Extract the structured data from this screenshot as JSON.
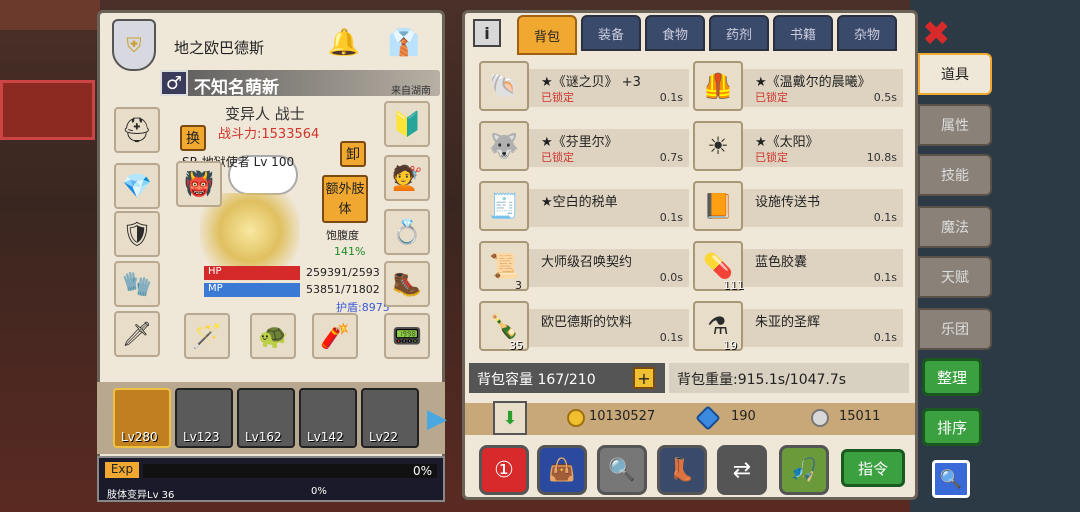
{
  "character": {
    "guild_name": "地之欧巴德斯",
    "player_name": "不知名萌新",
    "origin": "来自湖南",
    "gender_icon": "♂",
    "class": "变异人 战士",
    "power": "战斗力:1533564",
    "title": "SR  地狱使者 Lv 100",
    "swap_label": "换",
    "unequip_label": "卸",
    "extra_limb_label": "额外肢体",
    "satiety_label": "饱腹度",
    "satiety_value": "141%",
    "hp_label": "HP",
    "hp_value": "259391/2593",
    "mp_label": "MP",
    "mp_value": "53851/71802",
    "armor": "护盾:8975"
  },
  "roster": [
    {
      "level": "Lv280"
    },
    {
      "level": "Lv123"
    },
    {
      "level": "Lv162"
    },
    {
      "level": "Lv142"
    },
    {
      "level": "Lv22"
    }
  ],
  "exp": {
    "label": "Exp",
    "percent": "0%",
    "mutation_label": "肢体变异Lv 36",
    "mutation_percent": "0%"
  },
  "inventory": {
    "info_label": "i",
    "tabs": [
      "背包",
      "装备",
      "食物",
      "药剂",
      "书籍",
      "杂物"
    ],
    "items": [
      {
        "name": "★《谜之贝》 +3",
        "locked": "已锁定",
        "weight": "0.1s",
        "count": ""
      },
      {
        "name": "★《温戴尔的晨曦》",
        "locked": "已锁定",
        "weight": "0.5s",
        "count": ""
      },
      {
        "name": "★《芬里尔》",
        "locked": "已锁定",
        "weight": "0.7s",
        "count": ""
      },
      {
        "name": "★《太阳》",
        "locked": "已锁定",
        "weight": "10.8s",
        "count": ""
      },
      {
        "name": "★空白的税单",
        "locked": "",
        "weight": "0.1s",
        "count": ""
      },
      {
        "name": "设施传送书",
        "locked": "",
        "weight": "0.1s",
        "count": ""
      },
      {
        "name": "大师级召唤契约",
        "locked": "",
        "weight": "0.0s",
        "count": "3"
      },
      {
        "name": "蓝色胶囊",
        "locked": "",
        "weight": "0.1s",
        "count": "111"
      },
      {
        "name": "欧巴德斯的饮料",
        "locked": "",
        "weight": "0.1s",
        "count": "35"
      },
      {
        "name": "朱亚的圣辉",
        "locked": "",
        "weight": "0.1s",
        "count": "19"
      }
    ],
    "capacity": "背包容量 167/210",
    "plus_label": "+",
    "weight": "背包重量:915.1s/1047.7s",
    "gold": "10130527",
    "gems": "190",
    "silver": "15011",
    "command_label": "指令"
  },
  "side": {
    "close_label": "✖",
    "tabs": [
      "道具",
      "属性",
      "技能",
      "魔法",
      "天赋",
      "乐团"
    ],
    "organize_label": "整理",
    "sort_label": "排序"
  }
}
